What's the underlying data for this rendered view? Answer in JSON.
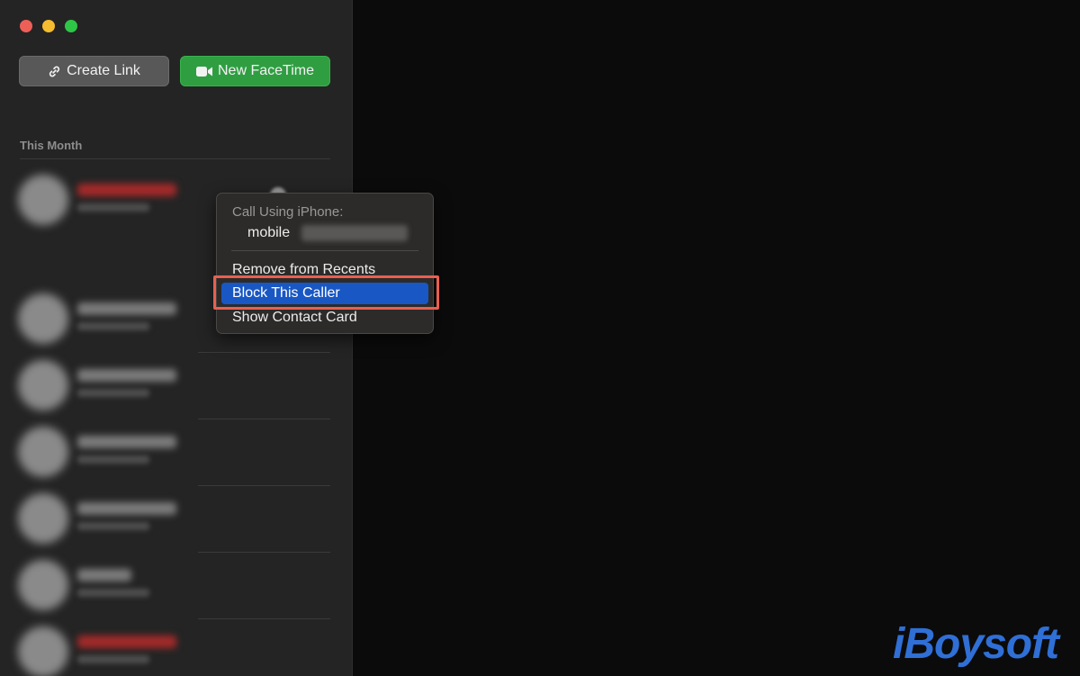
{
  "toolbar": {
    "create_link_label": "Create Link",
    "new_facetime_label": "New FaceTime"
  },
  "sections": {
    "this_month": "This Month"
  },
  "context_menu": {
    "header": "Call Using iPhone:",
    "phone_type": "mobile",
    "items": [
      "Remove from Recents",
      "Block This Caller",
      "Show Contact Card"
    ],
    "highlighted_item": "Block This Caller"
  },
  "watermark": "iBoysoft",
  "colors": {
    "sidebar_bg": "#242424",
    "facetime_green": "#2f9e41",
    "menu_highlight": "#1957c4",
    "annotation_red": "#e8604f",
    "watermark_blue": "#2f6fd6"
  },
  "icons": {
    "create_link": "link-icon",
    "new_facetime": "video-camera-icon"
  }
}
